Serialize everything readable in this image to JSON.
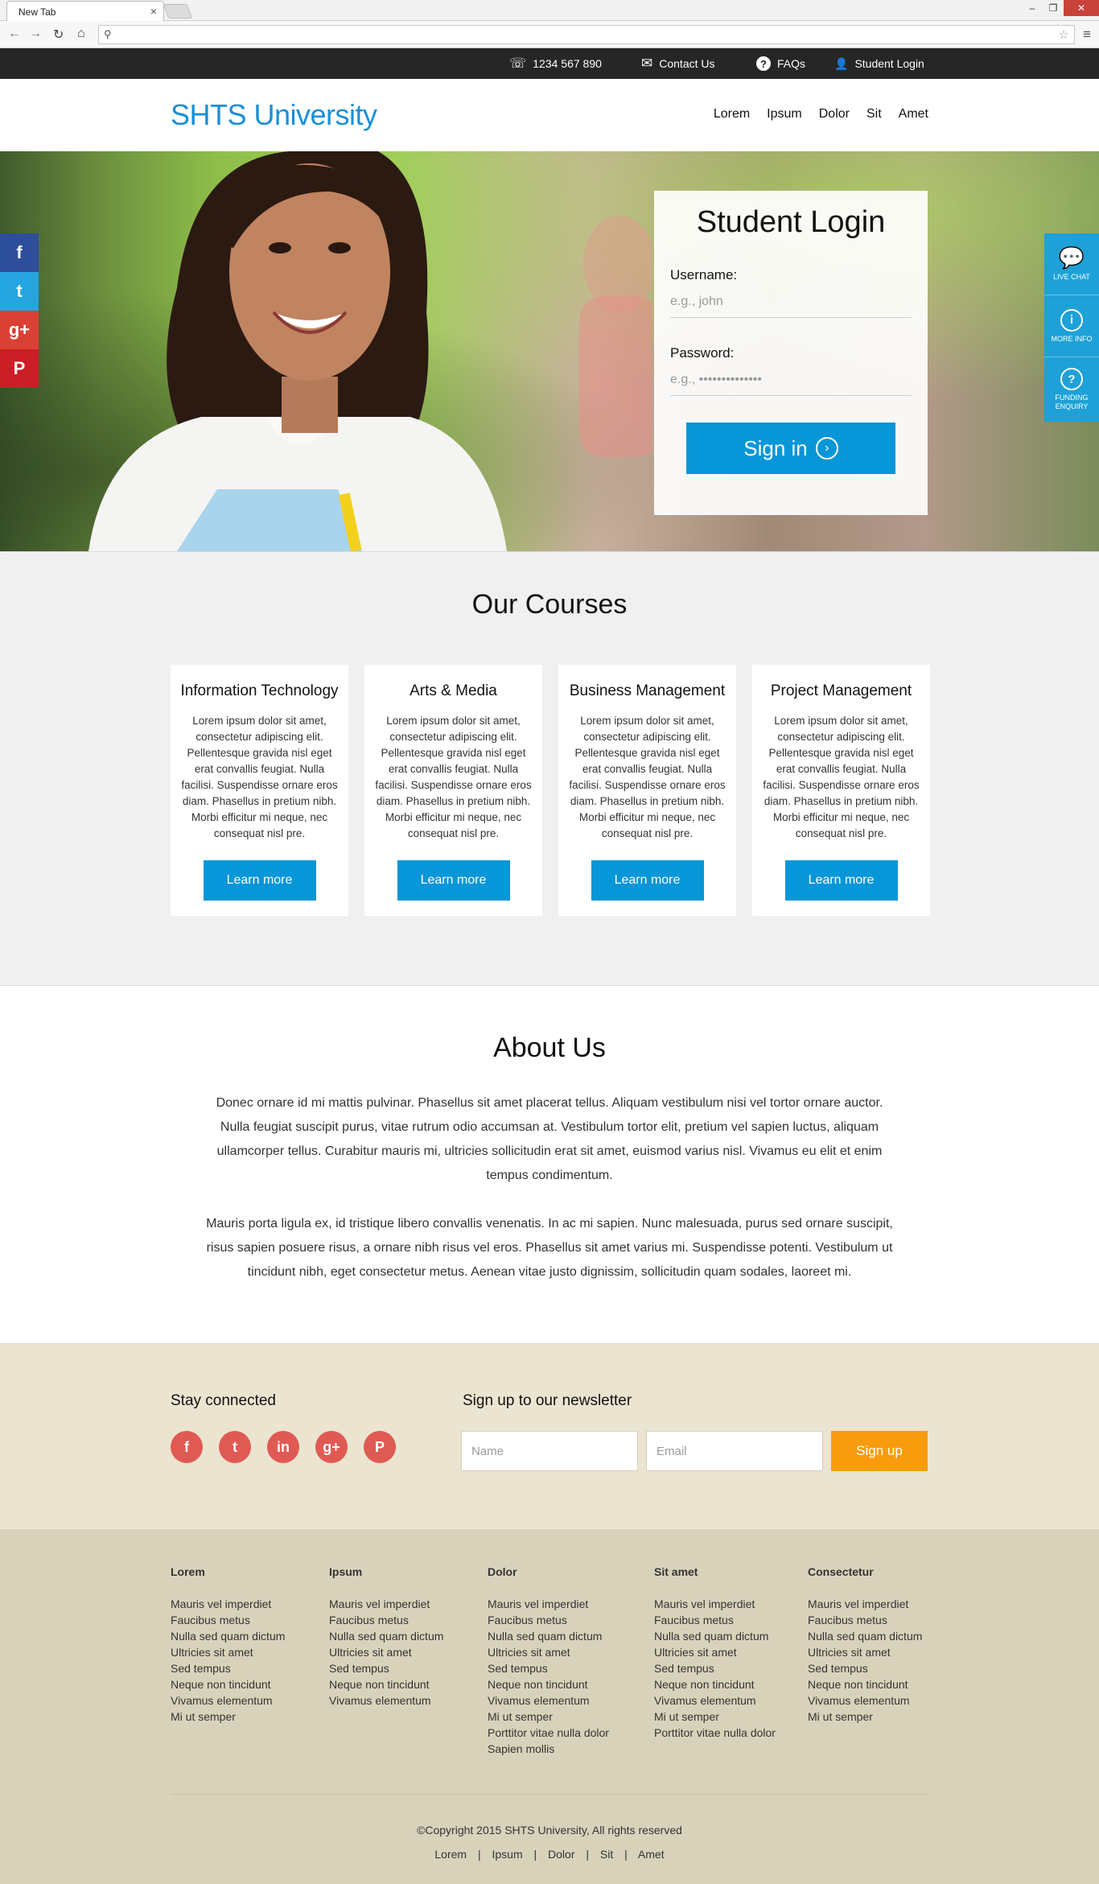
{
  "browser": {
    "tab_title": "New Tab",
    "close_glyph": "×",
    "min_glyph": "–",
    "max_glyph": "❐",
    "win_close_glyph": "✕",
    "back_glyph": "←",
    "forward_glyph": "→",
    "reload_glyph": "↻",
    "home_glyph": "⌂",
    "search_glyph": "⚲",
    "star_glyph": "☆",
    "menu_glyph": "≡"
  },
  "topbar": {
    "phone": "1234 567 890",
    "contact": "Contact Us",
    "faqs": "FAQs",
    "login": "Student Login",
    "phone_glyph": "☏",
    "mail_glyph": "✉",
    "faq_glyph": "?",
    "user_glyph": "👤"
  },
  "header": {
    "logo": "SHTS University",
    "nav": [
      "Lorem",
      "Ipsum",
      "Dolor",
      "Sit",
      "Amet"
    ]
  },
  "login": {
    "title": "Student Login",
    "username_label": "Username:",
    "username_placeholder": "e.g., john",
    "password_label": "Password:",
    "password_placeholder": "e.g., ••••••••••••••",
    "signin_label": "Sign in",
    "arrow_glyph": "›"
  },
  "social_side": {
    "facebook_glyph": "f",
    "twitter_glyph": "t",
    "googleplus_glyph": "g+",
    "pinterest_glyph": "P"
  },
  "help_side": [
    {
      "label": "LIVE CHAT",
      "glyph": "💬"
    },
    {
      "label": "MORE INFO",
      "glyph": "i"
    },
    {
      "label": "FUNDING ENQUIRY",
      "glyph": "?"
    }
  ],
  "courses": {
    "title": "Our Courses",
    "items": [
      {
        "title": "Information Technology",
        "desc": "Lorem ipsum dolor sit amet, consectetur adipiscing elit. Pellentesque gravida nisl eget erat convallis feugiat. Nulla facilisi. Suspendisse ornare eros diam. Phasellus in pretium nibh. Morbi efficitur mi neque, nec consequat nisl pre.",
        "button": "Learn more"
      },
      {
        "title": "Arts & Media",
        "desc": "Lorem ipsum dolor sit amet, consectetur adipiscing elit. Pellentesque gravida nisl eget erat convallis feugiat. Nulla facilisi. Suspendisse ornare eros diam. Phasellus in pretium nibh. Morbi efficitur mi neque, nec consequat nisl pre.",
        "button": "Learn more"
      },
      {
        "title": "Business Management",
        "desc": "Lorem ipsum dolor sit amet, consectetur adipiscing elit. Pellentesque gravida nisl eget erat convallis feugiat. Nulla facilisi. Suspendisse ornare eros diam. Phasellus in pretium nibh. Morbi efficitur mi neque, nec consequat nisl pre.",
        "button": "Learn more"
      },
      {
        "title": "Project Management",
        "desc": "Lorem ipsum dolor sit amet, consectetur adipiscing elit. Pellentesque gravida nisl eget erat convallis feugiat. Nulla facilisi. Suspendisse ornare eros diam. Phasellus in pretium nibh. Morbi efficitur mi neque, nec consequat nisl pre.",
        "button": "Learn more"
      }
    ]
  },
  "about": {
    "title": "About Us",
    "p1": "Donec ornare id mi mattis pulvinar. Phasellus sit amet placerat tellus. Aliquam vestibulum nisi vel tortor ornare auctor. Nulla feugiat suscipit purus, vitae rutrum odio accumsan at. Vestibulum tortor elit, pretium vel sapien luctus, aliquam ullamcorper tellus. Curabitur mauris mi, ultricies sollicitudin erat sit amet, euismod varius nisl. Vivamus eu elit et enim tempus condimentum.",
    "p2": "Mauris porta ligula ex, id tristique libero convallis venenatis. In ac mi sapien. Nunc malesuada, purus sed ornare suscipit, risus sapien posuere risus, a ornare nibh risus vel eros. Phasellus sit amet varius mi. Suspendisse potenti. Vestibulum ut tincidunt nibh, eget consectetur metus. Aenean vitae justo dignissim, sollicitudin quam sodales, laoreet mi."
  },
  "newsletter": {
    "stay_connected": "Stay connected",
    "signup_title": "Sign up to our newsletter",
    "name_placeholder": "Name",
    "email_placeholder": "Email",
    "button": "Sign up",
    "social": [
      "f",
      "t",
      "in",
      "g+",
      "P"
    ]
  },
  "footer": {
    "columns": [
      {
        "title": "Lorem",
        "links": [
          "Mauris vel imperdiet",
          "Faucibus metus",
          "Nulla sed quam dictum",
          "Ultricies sit amet",
          "Sed tempus",
          "Neque non tincidunt",
          "Vivamus elementum",
          "Mi ut semper"
        ]
      },
      {
        "title": "Ipsum",
        "links": [
          "Mauris vel imperdiet",
          "Faucibus metus",
          "Nulla sed quam dictum",
          "Ultricies sit amet",
          "Sed tempus",
          "Neque non tincidunt",
          "Vivamus elementum"
        ]
      },
      {
        "title": "Dolor",
        "links": [
          "Mauris vel imperdiet",
          "Faucibus metus",
          "Nulla sed quam dictum",
          "Ultricies sit amet",
          "Sed tempus",
          "Neque non tincidunt",
          "Vivamus elementum",
          "Mi ut semper",
          "Porttitor vitae nulla dolor",
          "Sapien mollis"
        ]
      },
      {
        "title": "Sit amet",
        "links": [
          "Mauris vel imperdiet",
          "Faucibus metus",
          "Nulla sed quam dictum",
          "Ultricies sit amet",
          "Sed tempus",
          "Neque non tincidunt",
          "Vivamus elementum",
          "Mi ut semper",
          "Porttitor vitae nulla dolor"
        ]
      },
      {
        "title": "Consectetur",
        "links": [
          "Mauris vel imperdiet",
          "Faucibus metus",
          "Nulla sed quam dictum",
          "Ultricies sit amet",
          "Sed tempus",
          "Neque non tincidunt",
          "Vivamus elementum",
          "Mi ut semper"
        ]
      }
    ],
    "copyright": "©Copyright 2015 SHTS University, All rights reserved",
    "nav": [
      "Lorem",
      "Ipsum",
      "Dolor",
      "Sit",
      "Amet"
    ],
    "sep": "|"
  }
}
